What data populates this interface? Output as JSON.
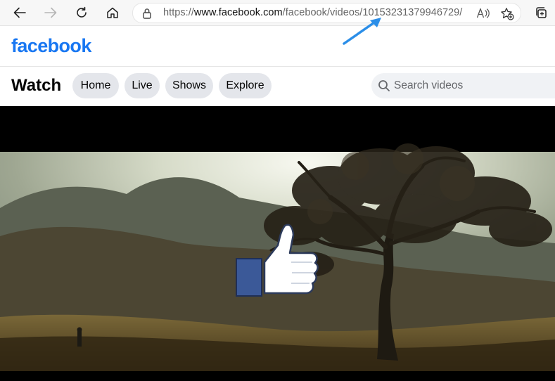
{
  "browser": {
    "url_scheme": "https://",
    "url_domain": "www.facebook.com",
    "url_path": "/facebook/videos/10153231379946729/"
  },
  "site": {
    "logo": "facebook",
    "brand_color": "#1877f2"
  },
  "watch": {
    "title": "Watch",
    "tabs": [
      "Home",
      "Live",
      "Shows",
      "Explore"
    ],
    "search_placeholder": "Search videos"
  },
  "video": {
    "overlay": "like-thumbs-up-icon"
  },
  "annotation": {
    "color": "#2b8ee8"
  }
}
